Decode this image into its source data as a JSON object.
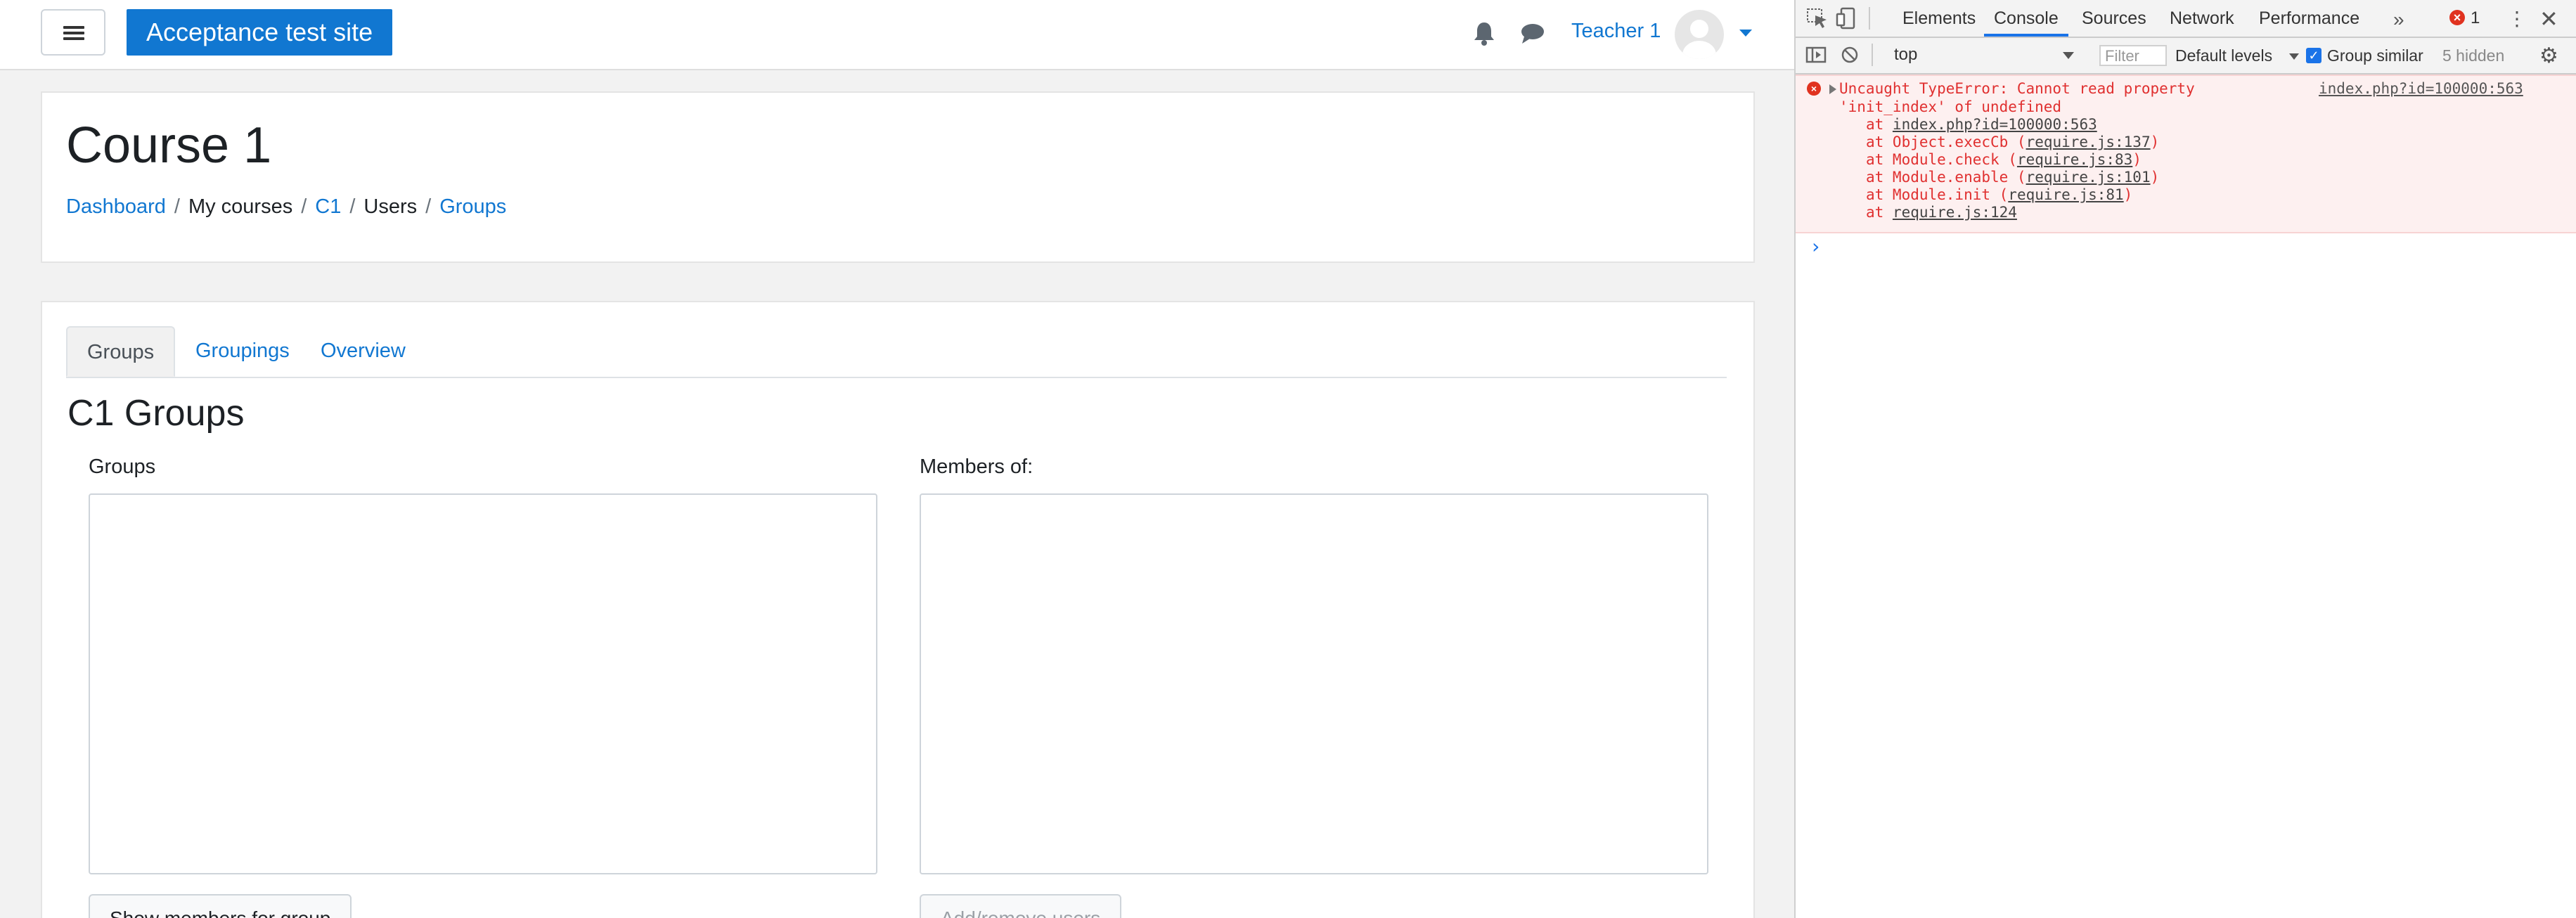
{
  "navbar": {
    "site_name": "Acceptance test site",
    "user_name": "Teacher 1"
  },
  "header": {
    "course_title": "Course 1",
    "breadcrumb": [
      {
        "label": "Dashboard",
        "link": true
      },
      {
        "label": "My courses",
        "link": false
      },
      {
        "label": "C1",
        "link": true
      },
      {
        "label": "Users",
        "link": false
      },
      {
        "label": "Groups",
        "link": true
      }
    ],
    "separator": "/"
  },
  "main": {
    "tabs": [
      {
        "label": "Groups",
        "active": true
      },
      {
        "label": "Groupings",
        "active": false
      },
      {
        "label": "Overview",
        "active": false
      }
    ],
    "heading": "C1 Groups",
    "groups_label": "Groups",
    "members_label": "Members of:",
    "show_members_button": "Show members for group",
    "add_remove_button": "Add/remove users"
  },
  "devtools": {
    "tabs": [
      "Elements",
      "Console",
      "Sources",
      "Network",
      "Performance"
    ],
    "active_tab": "Console",
    "more_tabs": "»",
    "error_count": "1",
    "context": "top",
    "filter_placeholder": "Filter",
    "levels": "Default levels",
    "group_similar": "Group similar",
    "hidden": "5 hidden",
    "error": {
      "message_line1": "Uncaught TypeError: Cannot read property",
      "message_line2": "'init_index' of undefined",
      "source": "index.php?id=100000:563",
      "stack": [
        {
          "prefix": "at ",
          "fn": "",
          "link": "index.php?id=100000:563"
        },
        {
          "prefix": "at Object.execCb (",
          "fn": "",
          "link": "require.js:137",
          "suffix": ")"
        },
        {
          "prefix": "at Module.check (",
          "fn": "",
          "link": "require.js:83",
          "suffix": ")"
        },
        {
          "prefix": "at Module.enable (",
          "fn": "",
          "link": "require.js:101",
          "suffix": ")"
        },
        {
          "prefix": "at Module.init (",
          "fn": "",
          "link": "require.js:81",
          "suffix": ")"
        },
        {
          "prefix": "at ",
          "fn": "",
          "link": "require.js:124"
        }
      ]
    },
    "prompt": "›"
  },
  "colors": {
    "brand": "#1177d1",
    "link": "#1177d1",
    "error_text": "#e03030",
    "error_bg": "#fdf0f0",
    "devtools_accent": "#1a73e8"
  }
}
